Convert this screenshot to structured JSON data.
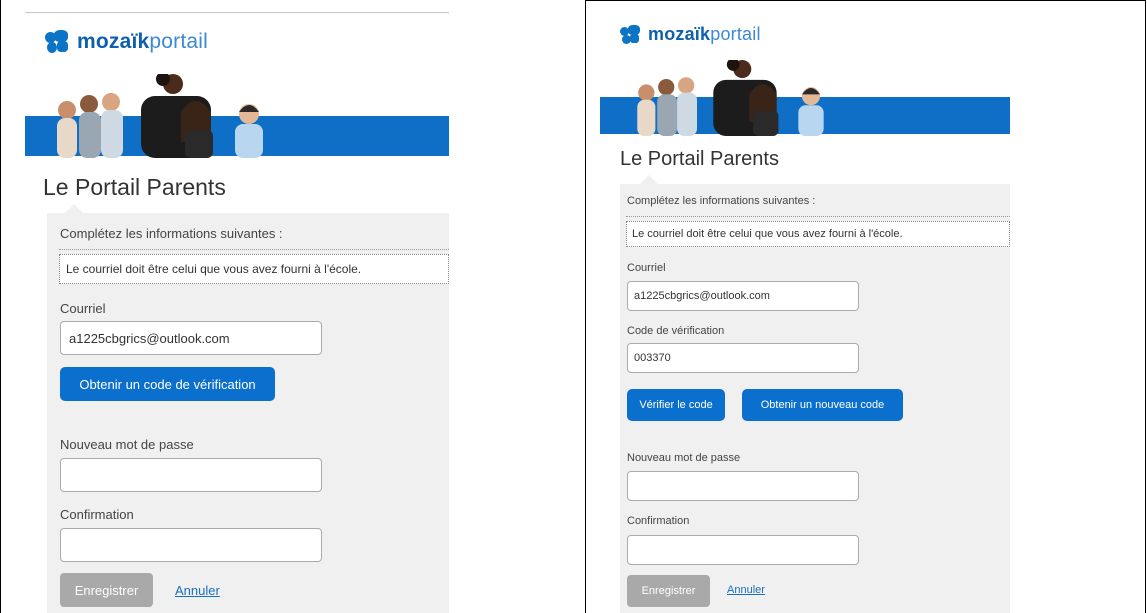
{
  "screens": [
    {
      "logo": {
        "bold": "mozaïk",
        "light": "portail"
      },
      "title": "Le Portail Parents",
      "intro": "Complétez les informations suivantes :",
      "info": "Le courriel doit être celui que vous avez fourni à l'école.",
      "email": {
        "label": "Courriel",
        "value": "a1225cbgrics@outlook.com"
      },
      "get_code_button": "Obtenir un code de vérification",
      "new_password": {
        "label": "Nouveau mot de passe",
        "value": ""
      },
      "confirmation": {
        "label": "Confirmation",
        "value": ""
      },
      "save_button": "Enregistrer",
      "cancel_link": "Annuler"
    },
    {
      "logo": {
        "bold": "mozaïk",
        "light": "portail"
      },
      "title": "Le Portail Parents",
      "intro": "Complétez les informations suivantes :",
      "info": "Le courriel doit être celui que vous avez fourni à l'école.",
      "email": {
        "label": "Courriel",
        "value": "a1225cbgrics@outlook.com"
      },
      "verification_code": {
        "label": "Code de vérification",
        "value": "003370"
      },
      "verify_button": "Vérifier le code",
      "new_code_button": "Obtenir un nouveau code",
      "new_password": {
        "label": "Nouveau mot de passe",
        "value": ""
      },
      "confirmation": {
        "label": "Confirmation",
        "value": ""
      },
      "save_button": "Enregistrer",
      "cancel_link": "Annuler"
    }
  ],
  "colors": {
    "accent": "#0b6fcd",
    "banner": "#0f6fc6",
    "form_bg": "#f0f0f0",
    "disabled": "#a9a9a9"
  }
}
